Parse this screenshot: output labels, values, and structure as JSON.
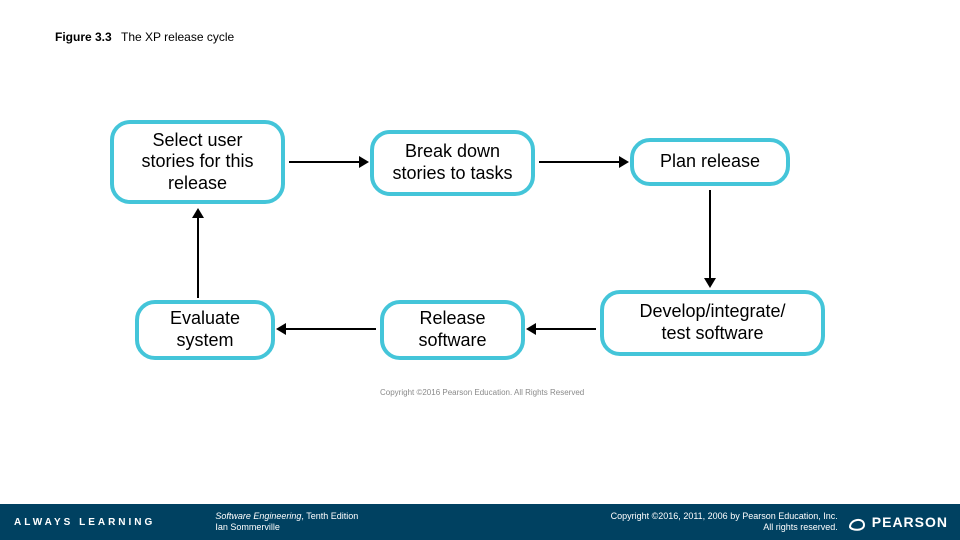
{
  "caption": {
    "number": "Figure 3.3",
    "title": "The XP release cycle"
  },
  "nodes": {
    "select": "Select user\nstories for this\nrelease",
    "break": "Break down\nstories to tasks",
    "plan": "Plan release",
    "develop": "Develop/integrate/\ntest software",
    "release": "Release\nsoftware",
    "evaluate": "Evaluate\nsystem"
  },
  "inner_copyright": "Copyright ©2016 Pearson Education. All Rights Reserved",
  "footer": {
    "always": "ALWAYS LEARNING",
    "book_title": "Software Engineering",
    "book_edition": ", Tenth Edition",
    "book_author": "Ian Sommerville",
    "copyright_line1": "Copyright ©2016, 2011, 2006 by Pearson Education, Inc.",
    "copyright_line2": "All rights reserved.",
    "brand": "PEARSON"
  }
}
